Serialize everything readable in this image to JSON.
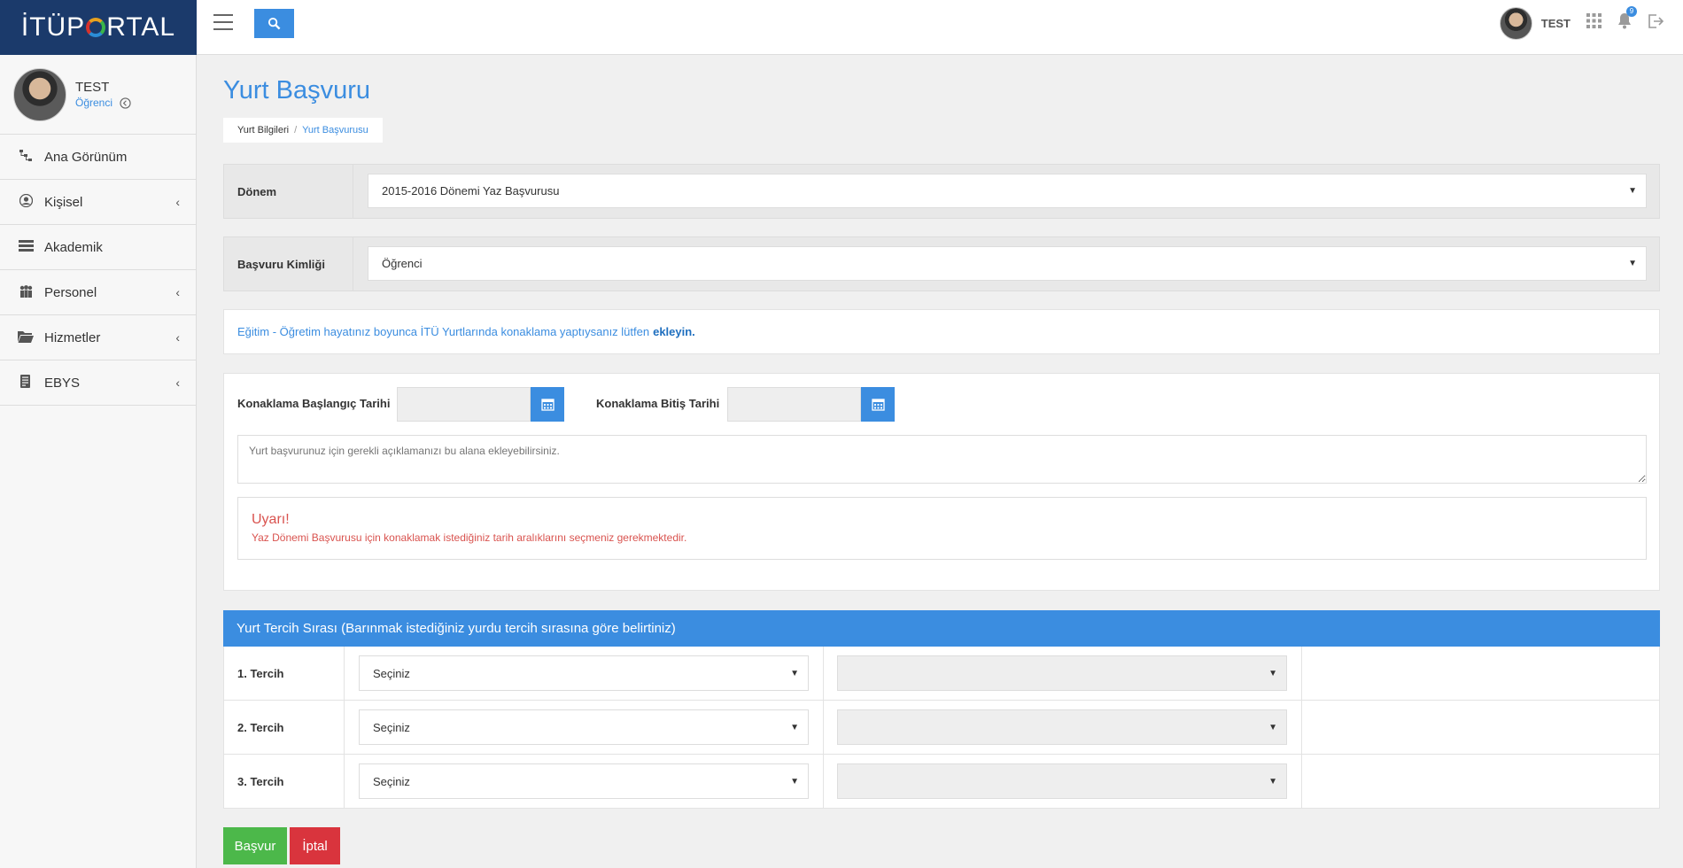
{
  "brand": {
    "prefix": "İTÜP",
    "suffix": "RTAL"
  },
  "topbar": {
    "user_name": "TEST",
    "notification_count": "9"
  },
  "sidebar": {
    "profile": {
      "name": "TEST",
      "role": "Öğrenci"
    },
    "items": [
      {
        "label": "Ana Görünüm",
        "icon": "sitemap-icon",
        "has_chevron": false
      },
      {
        "label": "Kişisel",
        "icon": "user-icon",
        "has_chevron": true
      },
      {
        "label": "Akademik",
        "icon": "stack-icon",
        "has_chevron": false
      },
      {
        "label": "Personel",
        "icon": "users-icon",
        "has_chevron": true
      },
      {
        "label": "Hizmetler",
        "icon": "folder-icon",
        "has_chevron": true
      },
      {
        "label": "EBYS",
        "icon": "document-icon",
        "has_chevron": true
      }
    ]
  },
  "page": {
    "title": "Yurt Başvuru",
    "breadcrumb": {
      "parent": "Yurt Bilgileri",
      "separator": "/",
      "current": "Yurt Başvurusu"
    }
  },
  "form": {
    "donem": {
      "label": "Dönem",
      "value": "2015-2016 Dönemi Yaz Başvurusu"
    },
    "kimlik": {
      "label": "Başvuru Kimliği",
      "value": "Öğrenci"
    },
    "info": {
      "text": "Eğitim - Öğretim hayatınız boyunca İTÜ Yurtlarında konaklama yaptıysanız lütfen",
      "link": "ekleyin."
    },
    "start_label": "Konaklama Başlangıç Tarihi",
    "end_label": "Konaklama Bitiş Tarihi",
    "textarea_placeholder": "Yurt başvurunuz için gerekli açıklamanızı bu alana ekleyebilirsiniz.",
    "warning": {
      "title": "Uyarı!",
      "text": "Yaz Dönemi Başvurusu için konaklamak istediğiniz tarih aralıklarını seçmeniz gerekmektedir."
    }
  },
  "preferences": {
    "header": "Yurt Tercih Sırası (Barınmak istediğiniz yurdu tercih sırasına göre belirtiniz)",
    "rows": [
      {
        "label": "1. Tercih",
        "select": "Seçiniz"
      },
      {
        "label": "2. Tercih",
        "select": "Seçiniz"
      },
      {
        "label": "3. Tercih",
        "select": "Seçiniz"
      }
    ]
  },
  "actions": {
    "submit": "Başvur",
    "cancel": "İptal"
  },
  "colors": {
    "primary": "#3b8de0",
    "brand": "#1b3a6b",
    "success": "#4cb84a",
    "danger": "#d9343d"
  }
}
